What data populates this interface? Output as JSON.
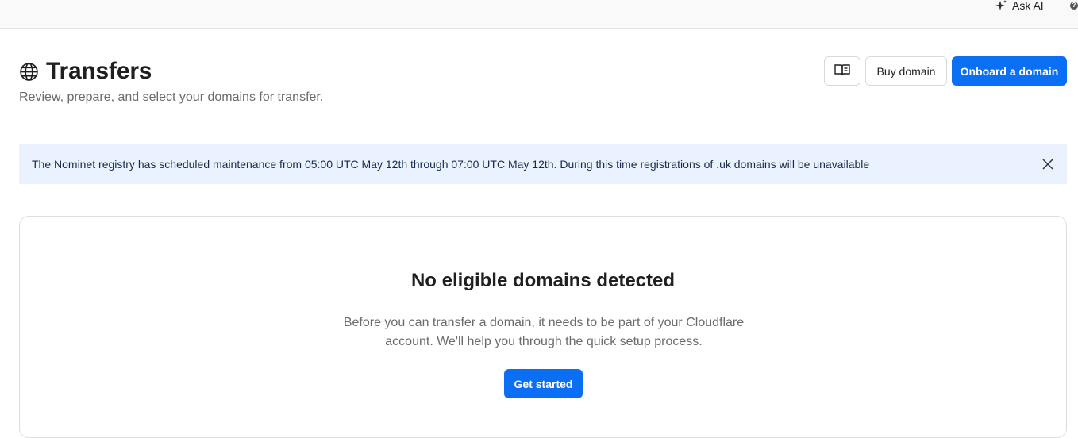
{
  "topbar": {
    "ask_ai_label": "Ask AI",
    "ask_ai_icon": "sparkle-icon",
    "help_icon": "help-icon"
  },
  "header": {
    "title": "Transfers",
    "title_icon": "globe-icon",
    "subtitle": "Review, prepare, and select your domains for transfer.",
    "actions": {
      "docs_icon": "book-icon",
      "buy_label": "Buy domain",
      "onboard_label": "Onboard a domain"
    }
  },
  "banner": {
    "message": "The Nominet registry has scheduled maintenance from 05:00 UTC May 12th through 07:00 UTC May 12th. During this time registrations of .uk domains will be unavailable",
    "close_icon": "close-icon"
  },
  "empty_state": {
    "title": "No eligible domains detected",
    "description": "Before you can transfer a domain, it needs to be part of your Cloudflare account. We'll help you through the quick setup process.",
    "cta_label": "Get started"
  },
  "colors": {
    "accent": "#0b6ff5",
    "banner_bg": "#e9f2fe",
    "text_primary": "#1f1f1f",
    "text_secondary": "#6b6b6b"
  }
}
